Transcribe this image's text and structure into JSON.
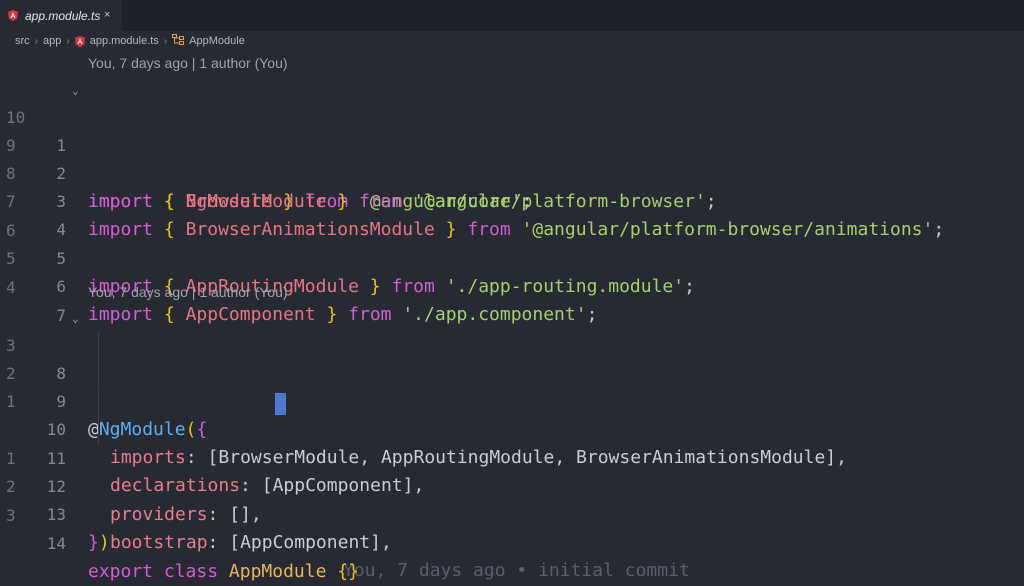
{
  "tab": {
    "title": "app.module.ts",
    "close": "×"
  },
  "breadcrumb": [
    "src",
    "app",
    "app.module.ts",
    "AppModule"
  ],
  "code_lens": [
    "You, 7 days ago | 1 author (You)",
    "You, 7 days ago | 1 author (You)"
  ],
  "lines": [
    {
      "rel": "10",
      "num": "1"
    },
    {
      "rel": "9",
      "num": "2"
    },
    {
      "rel": "8",
      "num": "3"
    },
    {
      "rel": "7",
      "num": "4"
    },
    {
      "rel": "6",
      "num": "5"
    },
    {
      "rel": "5",
      "num": "6"
    },
    {
      "rel": "4",
      "num": "7"
    },
    {
      "rel": "3",
      "num": "8"
    },
    {
      "rel": "2",
      "num": "9"
    },
    {
      "rel": "1",
      "num": "10"
    },
    {
      "rel": "",
      "num": "11"
    },
    {
      "rel": "1",
      "num": "12"
    },
    {
      "rel": "2",
      "num": "13"
    },
    {
      "rel": "3",
      "num": "14"
    }
  ],
  "tokens": {
    "import": "import",
    "from": "from",
    "export": "export",
    "class": "class",
    "ob": "{",
    "cb": "}",
    "empty_braces": "{}",
    "NgModule": "NgModule",
    "BrowserModule": "BrowserModule",
    "BrowserAnimationsModule": "BrowserAnimationsModule",
    "AppRoutingModule": "AppRoutingModule",
    "AppComponent": "AppComponent",
    "AppModule": "AppModule",
    "s1": "'@angular/core'",
    "s2": "'@angular/platform-browser'",
    "s3": "'@angular/platform-browser/animations'",
    "s4": "'./app-routing.module'",
    "s5": "'./app.component'",
    "semi": ";",
    "at": "@",
    "open_paren": "(",
    "close": ")",
    "imports": "imports",
    "declarations": "declarations",
    "providers": "providers",
    "bootstrap": "bootstrap",
    "colon": ": ",
    "lb": "[",
    "rb": "]",
    "comma": ",",
    "comma_sp": ", ",
    "empty_arr": "[]"
  },
  "inline_blame": "You, 7 days ago • initial commit",
  "colors": {
    "background": "#272a33",
    "keyword": "#d35fd1",
    "brace": "#e3c520",
    "identifier": "#e87484",
    "string": "#a7cf6b",
    "decorator": "#61afef",
    "class_name": "#e9b45b",
    "cursor": "#4d78cc"
  },
  "icons": {
    "file": "angular-icon",
    "symbol": "class-symbol-icon",
    "fold": "chevron-down-icon"
  }
}
